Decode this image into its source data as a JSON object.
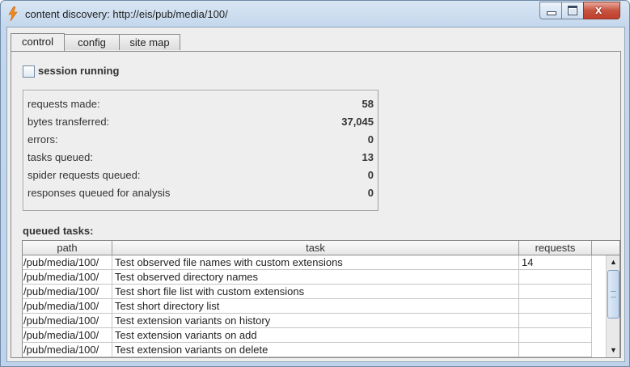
{
  "window": {
    "title": "content discovery: http://eis/pub/media/100/",
    "icon": "lightning-bolt-icon",
    "controls": [
      "minimize-icon",
      "maximize-icon",
      "close-icon"
    ],
    "close_glyph": "x"
  },
  "tabs": [
    {
      "label": "control",
      "active": true
    },
    {
      "label": "config",
      "active": false
    },
    {
      "label": "site map",
      "active": false
    }
  ],
  "control": {
    "session_label": "session running",
    "session_checked": false,
    "stats": [
      {
        "label": "requests made:",
        "value": "58"
      },
      {
        "label": "bytes transferred:",
        "value": "37,045"
      },
      {
        "label": "errors:",
        "value": "0"
      },
      {
        "label": "tasks queued:",
        "value": "13"
      },
      {
        "label": "spider requests queued:",
        "value": "0"
      },
      {
        "label": "responses queued for analysis",
        "value": "0"
      }
    ],
    "queued_label": "queued tasks:",
    "table": {
      "columns": [
        "path",
        "task",
        "requests"
      ],
      "rows": [
        {
          "path": "/pub/media/100/",
          "task": "Test observed file names with custom extensions",
          "requests": "14"
        },
        {
          "path": "/pub/media/100/",
          "task": "Test observed directory names",
          "requests": ""
        },
        {
          "path": "/pub/media/100/",
          "task": "Test short file list with custom extensions",
          "requests": ""
        },
        {
          "path": "/pub/media/100/",
          "task": "Test short directory list",
          "requests": ""
        },
        {
          "path": "/pub/media/100/",
          "task": "Test extension variants on history",
          "requests": ""
        },
        {
          "path": "/pub/media/100/",
          "task": "Test extension variants on add",
          "requests": ""
        },
        {
          "path": "/pub/media/100/",
          "task": "Test extension variants on delete",
          "requests": ""
        }
      ]
    }
  },
  "colors": {
    "titlebar": "#c4d7ec",
    "close_button": "#c7533f",
    "panel_bg": "#eeeeee",
    "icon_orange": "#f08a1c"
  }
}
